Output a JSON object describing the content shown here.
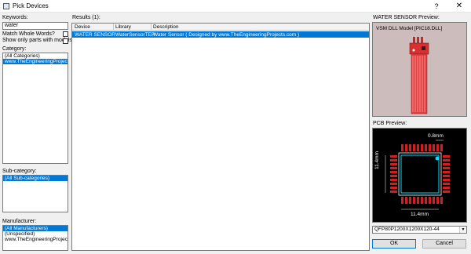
{
  "window": {
    "title": "Pick Devices",
    "help_label": "?",
    "close_label": "✕"
  },
  "search": {
    "keywords_label": "Keywords:",
    "keywords_value": "water",
    "match_whole_words_label": "Match Whole Words?",
    "show_models_label": "Show only parts with models?",
    "match_whole_words_checked": false,
    "show_models_checked": false
  },
  "category": {
    "label": "Category:",
    "items": [
      "(All Categories)",
      "www.TheEngineeringProjects.co"
    ],
    "selected_index": 1
  },
  "subcategory": {
    "label": "Sub-category:",
    "items": [
      "(All Sub-categories)"
    ],
    "selected_index": 0
  },
  "manufacturer": {
    "label": "Manufacturer:",
    "items": [
      "(All Manufacturers)",
      "(Unspecified)",
      "www.TheEngineeringProjects.co"
    ],
    "selected_index": 0
  },
  "results": {
    "label": "Results (1):",
    "columns": [
      "Device",
      "Library",
      "Description"
    ],
    "rows": [
      {
        "device": "WATER SENSOR",
        "library": "WaterSensorTEP",
        "description": "Water Sensor ( Designed by www.TheEngineeringProjects.com )"
      }
    ]
  },
  "preview": {
    "label": "WATER SENSOR Preview:",
    "model_text": "VSM DLL Model [PIC18.DLL]"
  },
  "pcb": {
    "label": "PCB Preview:",
    "dim_top": "0.8mm",
    "dim_side": "11.4mm",
    "dim_bottom": "11.4mm",
    "package": "QFP80P1200X1200X120-44"
  },
  "buttons": {
    "ok": "OK",
    "cancel": "Cancel"
  }
}
